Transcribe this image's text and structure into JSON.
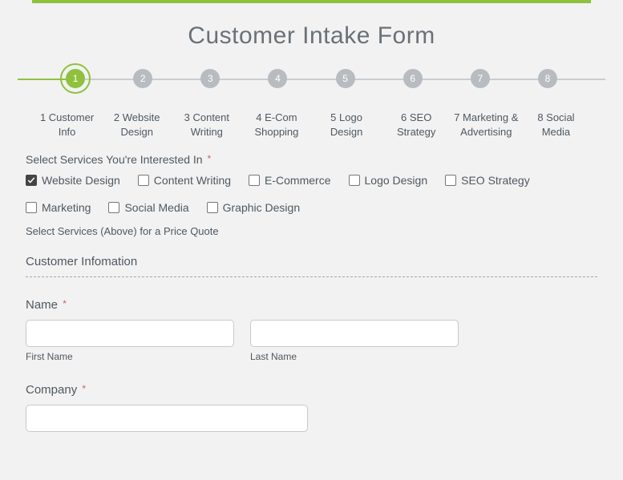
{
  "title": "Customer Intake Form",
  "stepper": {
    "active_index": 0,
    "steps": [
      {
        "num": "1",
        "label": "1 Customer Info"
      },
      {
        "num": "2",
        "label": "2 Website Design"
      },
      {
        "num": "3",
        "label": "3 Content Writing"
      },
      {
        "num": "4",
        "label": "4 E-Com Shopping"
      },
      {
        "num": "5",
        "label": "5 Logo Design"
      },
      {
        "num": "6",
        "label": "6 SEO Strategy"
      },
      {
        "num": "7",
        "label": "7 Marketing & Advertising"
      },
      {
        "num": "8",
        "label": "8 Social Media"
      }
    ]
  },
  "services": {
    "label": "Select Services You're Interested In",
    "required": "*",
    "helper": "Select Services (Above) for a Price Quote",
    "options": [
      {
        "label": "Website Design",
        "checked": true
      },
      {
        "label": "Content Writing",
        "checked": false
      },
      {
        "label": "E-Commerce",
        "checked": false
      },
      {
        "label": "Logo Design",
        "checked": false
      },
      {
        "label": "SEO Strategy",
        "checked": false
      },
      {
        "label": "Marketing",
        "checked": false
      },
      {
        "label": "Social Media",
        "checked": false
      },
      {
        "label": "Graphic Design",
        "checked": false
      }
    ]
  },
  "section_customer_info": "Customer Infomation",
  "name": {
    "label": "Name",
    "required": "*",
    "first_value": "",
    "last_value": "",
    "first_sub": "First Name",
    "last_sub": "Last Name"
  },
  "company": {
    "label": "Company",
    "required": "*",
    "value": ""
  }
}
